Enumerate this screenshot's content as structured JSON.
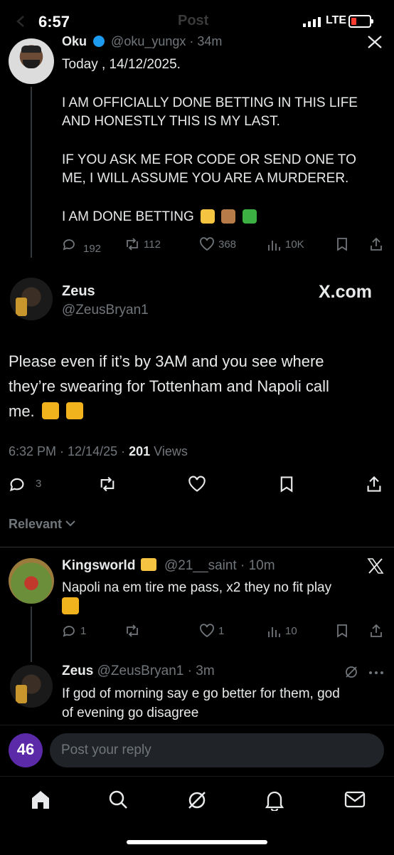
{
  "status_bar": {
    "time": "6:57",
    "network": "LTE",
    "battery_level": 0.2,
    "battery_color": "#ff3b30"
  },
  "header": {
    "title": "Post"
  },
  "quoted_post": {
    "author_name": "Oku",
    "handle_meta": "@oku_yungx · 34m",
    "verified": true,
    "lines": [
      "Today , 14/12/2025.",
      "I AM OFFICIALLY DONE BETTING IN THIS LIFE",
      "AND HONESTLY THIS IS MY LAST.",
      "IF YOU ASK ME FOR CODE OR SEND ONE TO",
      "ME, I WILL ASSUME YOU ARE A MURDERER.",
      "I AM DONE BETTING"
    ],
    "stats": {
      "replies": "192",
      "reposts": "112",
      "likes": "368",
      "views": "10K"
    }
  },
  "main_post": {
    "author_name": "Zeus",
    "handle": "@ZeusBryan1",
    "brand": "X.com",
    "text_lines": [
      "Please even if it’s by 3AM and you see where",
      "they’re swearing for Tottenham  and Napoli call",
      "me."
    ],
    "meta_time": "6:32 PM · 12/14/25 ·",
    "views_count": "201",
    "views_label": "Views",
    "stats": {
      "replies": "3"
    }
  },
  "sort": {
    "label": "Relevant"
  },
  "replies": [
    {
      "author_name": "Kingsworld",
      "handle_meta": "@21__saint · 10m",
      "lines": [
        "Napoli na em tire me pass, x2 they no fit play"
      ],
      "stats": {
        "replies": "1",
        "likes": "1",
        "views": "10"
      }
    },
    {
      "author_name": "Zeus",
      "handle_meta": "@ZeusBryan1 · 3m",
      "lines": [
        "If god of morning say e go better for them, god",
        "of evening go disagree"
      ]
    }
  ],
  "composer": {
    "placeholder": "Post your reply",
    "avatar_badge": "46"
  },
  "colors": {
    "accent": "#1d9bf0",
    "muted": "#71767b",
    "text": "#e7e9ea",
    "divider": "#2f3336"
  },
  "icons": [
    "home-icon",
    "search-icon",
    "grok-icon",
    "notifications-icon",
    "messages-icon"
  ]
}
